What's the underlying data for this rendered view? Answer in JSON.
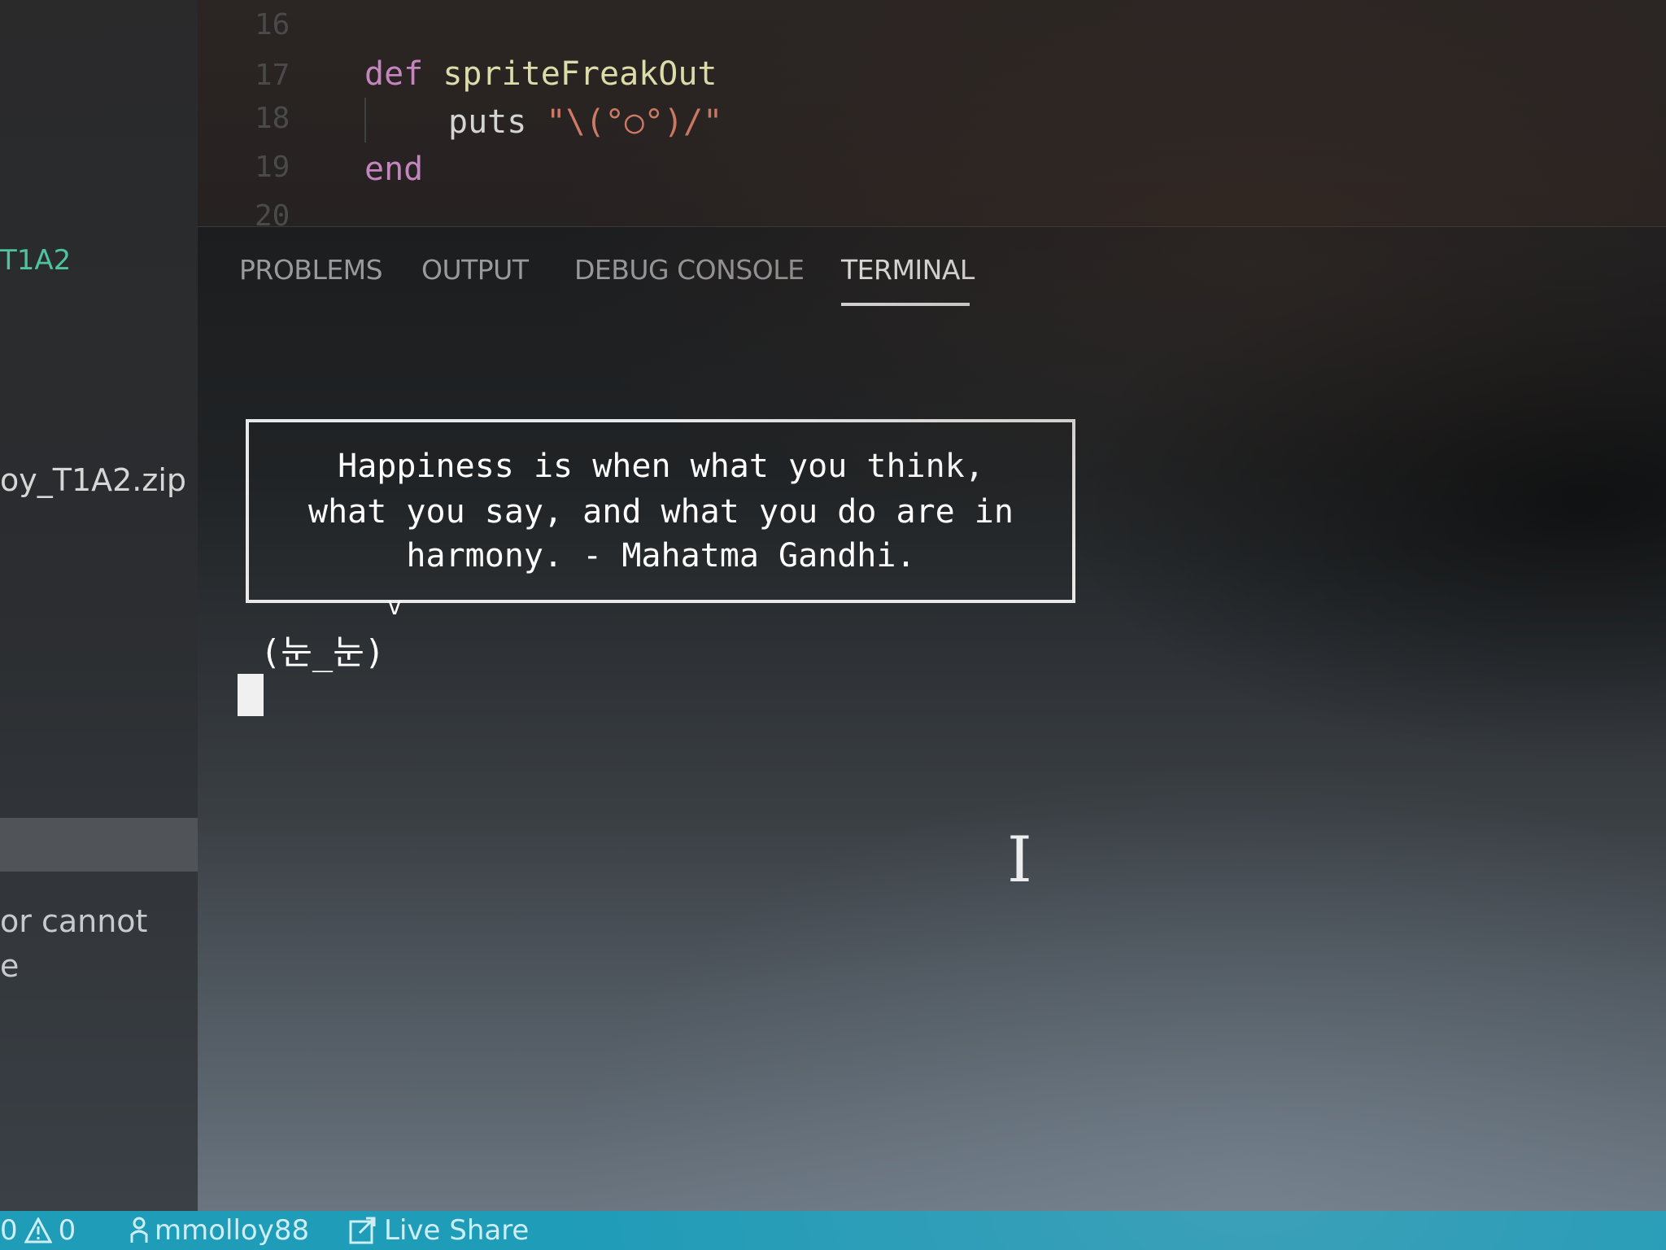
{
  "editor": {
    "lines": [
      {
        "number": "16"
      },
      {
        "number": "17",
        "keyword": "def",
        "function": "spriteFreakOut"
      },
      {
        "number": "18",
        "method": "puts",
        "string": "\"\\(°○°)/\""
      },
      {
        "number": "19",
        "keyword": "end"
      },
      {
        "number": "20"
      }
    ]
  },
  "sidebar": {
    "folder_label": "T1A2",
    "zip_file": "oy_T1A2.zip",
    "message_line1": "or cannot",
    "message_line2": "e"
  },
  "panel": {
    "tabs": [
      {
        "label": "PROBLEMS",
        "active": false
      },
      {
        "label": "OUTPUT",
        "active": false
      },
      {
        "label": "DEBUG CONSOLE",
        "active": false
      },
      {
        "label": "TERMINAL",
        "active": true
      }
    ]
  },
  "terminal": {
    "quote_lines": [
      "Happiness is when what you think,",
      "what you say, and what you do are in",
      "harmony. - Mahatma Gandhi."
    ],
    "bubble_tail": "v",
    "face": "(눈_눈)"
  },
  "statusbar": {
    "errors": "0",
    "warnings": "0",
    "user": "mmolloy88",
    "live_share": "Live Share",
    "color": "#1f9cb8"
  },
  "icons": [
    "warning-icon",
    "person-icon",
    "live-share-icon",
    "text-cursor-icon"
  ]
}
